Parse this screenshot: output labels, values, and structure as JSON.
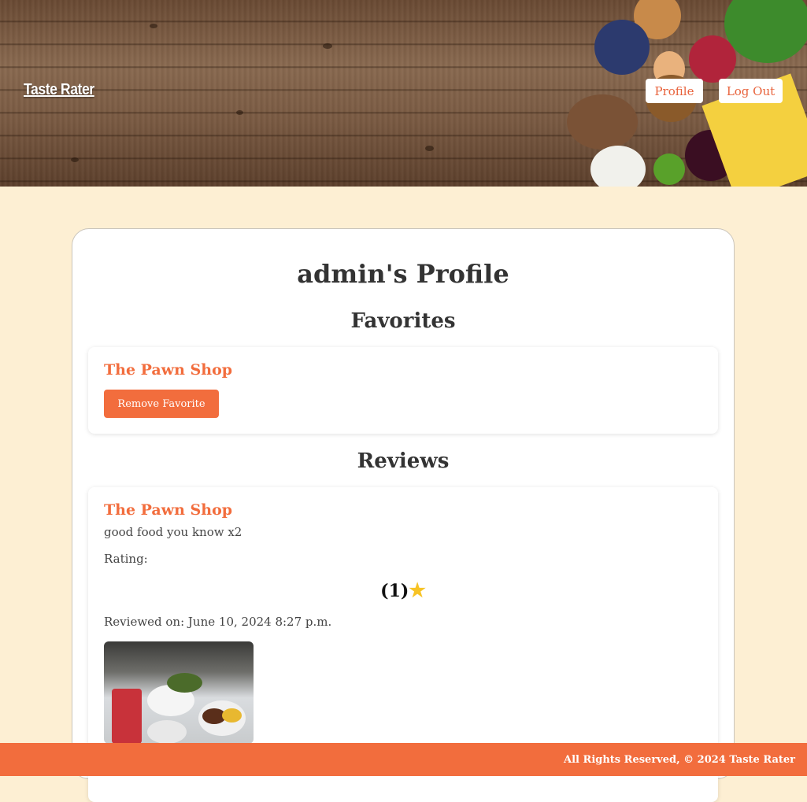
{
  "header": {
    "brand": "Taste Rater",
    "nav": {
      "profile": "Profile",
      "logout": "Log Out"
    }
  },
  "profile": {
    "title": "admin's Profile",
    "favorites": {
      "heading": "Favorites",
      "items": [
        {
          "name": "The Pawn Shop",
          "remove_label": "Remove Favorite"
        }
      ]
    },
    "reviews": {
      "heading": "Reviews",
      "items": [
        {
          "restaurant": "The Pawn Shop",
          "comment": "good food you know x2",
          "rating_label": "Rating:",
          "rating_value": "(1)",
          "rating_stars": 1,
          "reviewed_on": "Reviewed on: June 10, 2024 8:27 p.m."
        }
      ]
    }
  },
  "footer": {
    "text": "All Rights Reserved, © 2024 Taste Rater"
  },
  "colors": {
    "accent": "#f26d3d",
    "background": "#fdefd3",
    "star": "#f7c325"
  }
}
